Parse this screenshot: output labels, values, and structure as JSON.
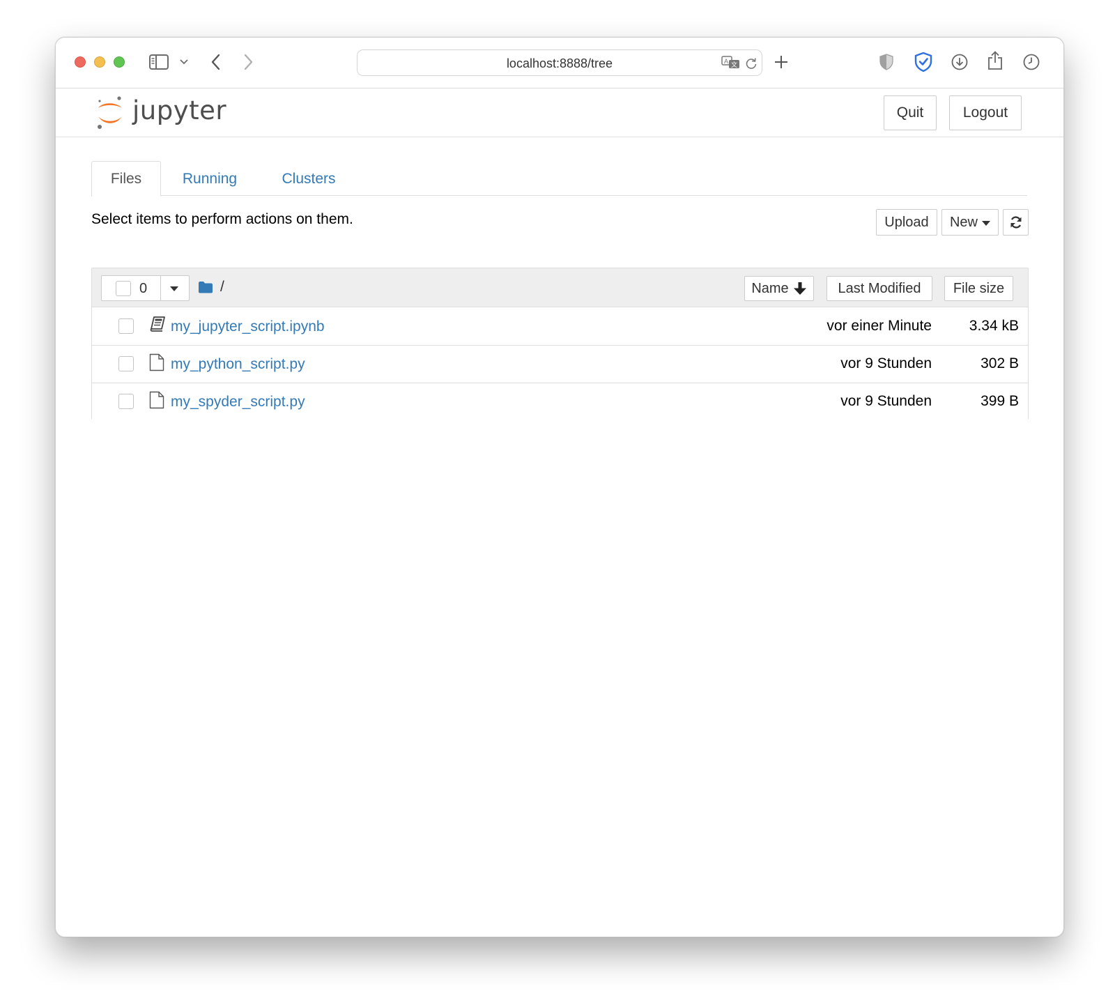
{
  "browser": {
    "url": "localhost:8888/tree"
  },
  "header": {
    "logo_text": "jupyter",
    "quit_label": "Quit",
    "logout_label": "Logout",
    "logo_colors": {
      "orange": "#f37626",
      "gray": "#767677"
    }
  },
  "tabs": [
    {
      "label": "Files",
      "active": true
    },
    {
      "label": "Running",
      "active": false
    },
    {
      "label": "Clusters",
      "active": false
    }
  ],
  "toolbar": {
    "hint": "Select items to perform actions on them.",
    "upload_label": "Upload",
    "new_label": "New",
    "refresh_icon": "refresh-icon"
  },
  "list": {
    "selected_count": "0",
    "breadcrumb": "/",
    "columns": {
      "name": "Name",
      "last_modified": "Last Modified",
      "file_size": "File size"
    },
    "items": [
      {
        "icon": "notebook-icon",
        "name": "my_jupyter_script.ipynb",
        "modified": "vor einer Minute",
        "size": "3.34 kB"
      },
      {
        "icon": "file-icon",
        "name": "my_python_script.py",
        "modified": "vor 9 Stunden",
        "size": "302 B"
      },
      {
        "icon": "file-icon",
        "name": "my_spyder_script.py",
        "modified": "vor 9 Stunden",
        "size": "399 B"
      }
    ]
  },
  "colors": {
    "link": "#337ab7",
    "shield_accent": "#2f6fe0"
  }
}
